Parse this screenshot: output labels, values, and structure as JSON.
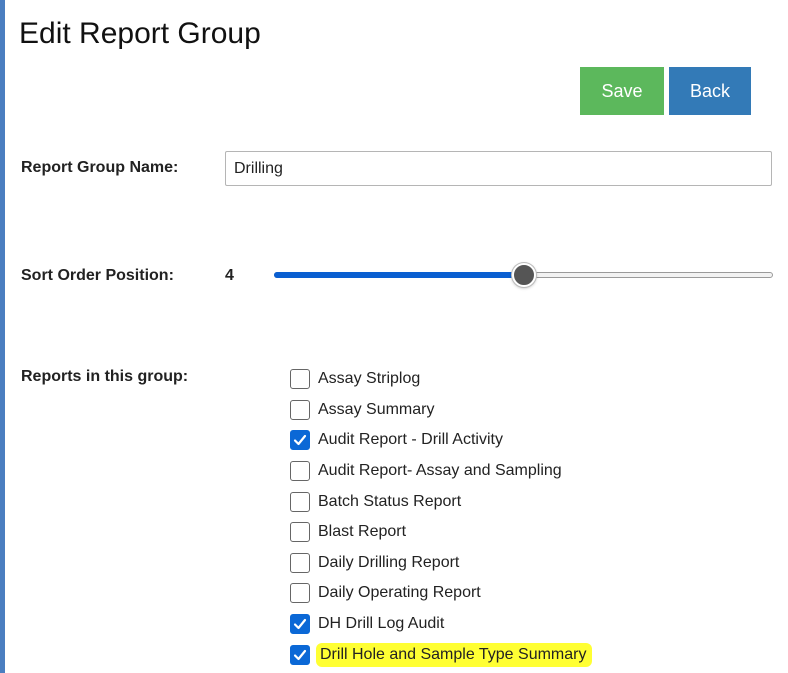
{
  "page": {
    "title": "Edit Report Group"
  },
  "toolbar": {
    "save_label": "Save",
    "back_label": "Back"
  },
  "colors": {
    "save_button": "#5cb85c",
    "back_button": "#337ab7",
    "checkbox_checked": "#0b68d6",
    "highlight": "#ffff33",
    "slider_fill": "#0a5fd1"
  },
  "form": {
    "name_label": "Report Group Name:",
    "name_value": "Drilling",
    "sort_label": "Sort Order Position:",
    "sort_value": "4",
    "sort_slider_fraction": 0.5,
    "reports_label": "Reports in this group:"
  },
  "reports": [
    {
      "label": "Assay Striplog",
      "checked": false,
      "highlighted": false
    },
    {
      "label": "Assay Summary",
      "checked": false,
      "highlighted": false
    },
    {
      "label": "Audit Report - Drill Activity",
      "checked": true,
      "highlighted": false
    },
    {
      "label": "Audit Report- Assay and Sampling",
      "checked": false,
      "highlighted": false
    },
    {
      "label": "Batch Status Report",
      "checked": false,
      "highlighted": false
    },
    {
      "label": "Blast Report",
      "checked": false,
      "highlighted": false
    },
    {
      "label": "Daily Drilling Report",
      "checked": false,
      "highlighted": false
    },
    {
      "label": "Daily Operating Report",
      "checked": false,
      "highlighted": false
    },
    {
      "label": "DH Drill Log Audit",
      "checked": true,
      "highlighted": false
    },
    {
      "label": "Drill Hole and Sample Type Summary",
      "checked": true,
      "highlighted": true
    }
  ]
}
